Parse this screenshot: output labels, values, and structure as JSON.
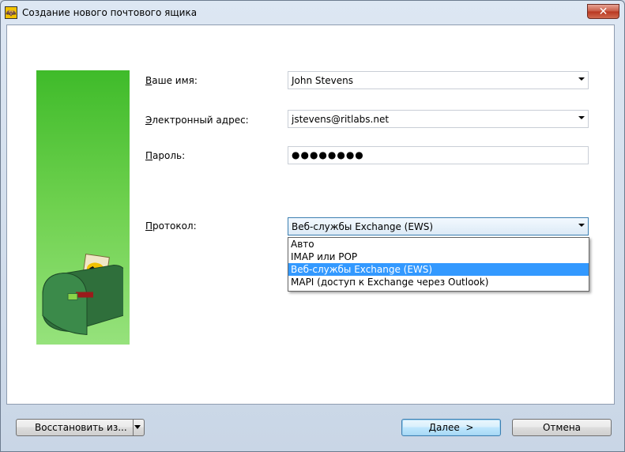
{
  "window": {
    "title": "Создание нового почтового ящика",
    "close_symbol": "✕",
    "app_icon_symbol": "🦇"
  },
  "form": {
    "name_label_accel": "В",
    "name_label_rest": "аше имя:",
    "name_value": "John Stevens",
    "email_label_accel": "Э",
    "email_label_rest": "лектронный адрес:",
    "email_value": "jstevens@ritlabs.net",
    "password_label_accel": "П",
    "password_label_rest": "ароль:",
    "password_value": "●●●●●●●●",
    "protocol_label_accel": "П",
    "protocol_label_rest": "ротокол:",
    "protocol_value": "Веб-службы Exchange (EWS)"
  },
  "protocol_options": [
    "Авто",
    "IMAP или POP",
    "Веб-службы Exchange (EWS)",
    "MAPI (доступ к Exchange через Outlook)"
  ],
  "footer": {
    "restore_label": "Восстановить из...",
    "next_label_accel": "Д",
    "next_label_rest": "алее  >",
    "cancel_label": "Отмена"
  },
  "colors": {
    "sidebar_green": "#3fbb2a",
    "selection_blue": "#3399ff",
    "close_red": "#c75a44"
  }
}
